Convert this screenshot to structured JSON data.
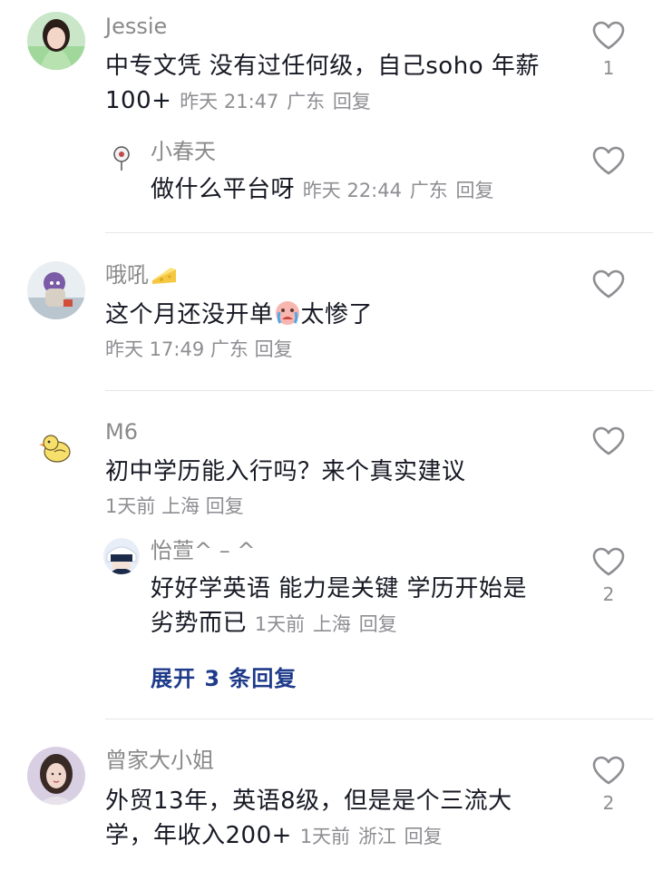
{
  "colors": {
    "background": "#ffffff",
    "username": "#8a8a8a",
    "comment_text": "#161823",
    "meta_text": "#8e8e93",
    "expand_link": "#1e3a8a",
    "divider": "#e6e6e6"
  },
  "comments": [
    {
      "username": "Jessie",
      "text_line1": "中专文凭 没有过任何级，自己soho 年薪",
      "text_line2_start": "100+",
      "time": "昨天 21:47",
      "location": "广东",
      "reply_label": "回复",
      "like_count": "1",
      "like_icon": "heart-outline-icon",
      "replies": [
        {
          "username": "小春天",
          "text": "做什么平台呀",
          "time": "昨天 22:44",
          "location": "广东",
          "reply_label": "回复",
          "like_icon": "heart-outline-icon"
        }
      ]
    },
    {
      "username": "哦吼",
      "username_emoji": "cheese-emoji",
      "text_part1": "这个月还没开单",
      "text_emoji": "crying-face-emoji",
      "text_part2": "太惨了",
      "time": "昨天 17:49",
      "location": "广东",
      "reply_label": "回复",
      "like_icon": "heart-outline-icon"
    },
    {
      "username": "M6",
      "text": "初中学历能入行吗？来个真实建议",
      "time": "1天前",
      "location": "上海",
      "reply_label": "回复",
      "like_icon": "heart-outline-icon",
      "replies": [
        {
          "username": "怡萱^ – ^",
          "text_line1": "好好学英语 能力是关键 学历开始是",
          "text_line2_start": "劣势而已",
          "time": "1天前",
          "location": "上海",
          "reply_label": "回复",
          "like_count": "2",
          "like_icon": "heart-outline-icon"
        }
      ],
      "expand_label": "展开 3 条回复"
    },
    {
      "username": "曾家大小姐",
      "text_line1": "外贸13年，英语8级，但是是个三流大",
      "text_line2_start": "学，年收入200+",
      "time": "1天前",
      "location": "浙江",
      "reply_label": "回复",
      "like_count": "2",
      "like_icon": "heart-outline-icon"
    }
  ]
}
